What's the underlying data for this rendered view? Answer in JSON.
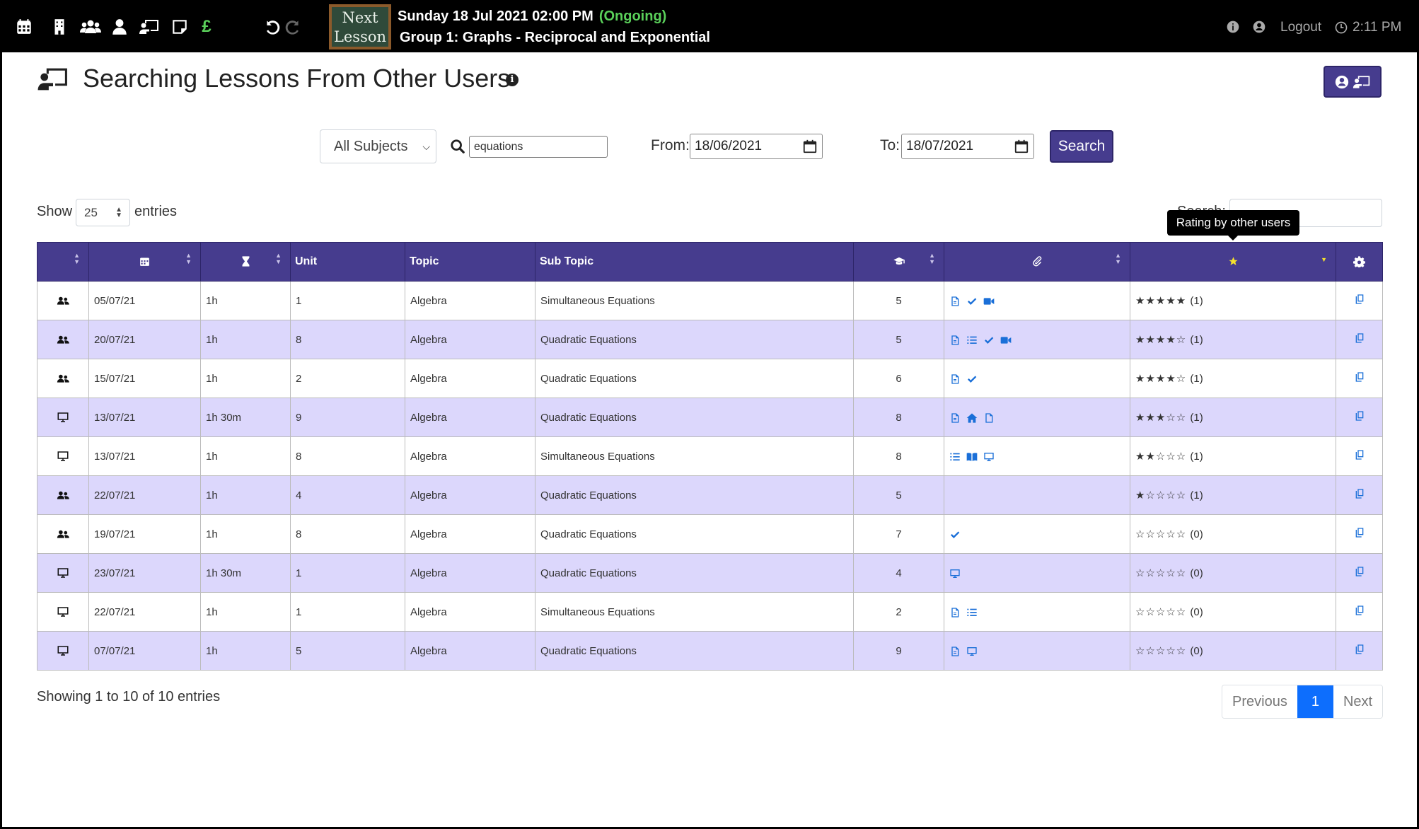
{
  "topbar": {
    "icons": [
      "calendar-icon",
      "building-icon",
      "group-icon",
      "user-icon",
      "presentation-icon",
      "note-icon",
      "pound-icon",
      "undo-icon",
      "redo-icon"
    ],
    "pound_symbol": "£",
    "next_lesson_line1": "Next",
    "next_lesson_line2": "Lesson",
    "lesson_datetime": "Sunday 18 Jul 2021 02:00 PM",
    "lesson_status": "(Ongoing)",
    "lesson_title": "Group 1: Graphs - Reciprocal and Exponential",
    "logout_label": "Logout",
    "time": "2:11 PM",
    "accent_color": "#5ad05a"
  },
  "page": {
    "title": "Searching Lessons From Other Users",
    "info_glyph": "i"
  },
  "filters": {
    "subject": "All Subjects",
    "search_value": "equations",
    "from_label": "From:",
    "from_value": "18/06/2021",
    "to_label": "To:",
    "to_value": "18/07/2021",
    "search_button": "Search"
  },
  "table_controls": {
    "show_label": "Show",
    "entries_value": "25",
    "entries_label": "entries",
    "search_label": "Search:"
  },
  "tooltip": "Rating by other users",
  "table": {
    "headers": {
      "unit": "Unit",
      "topic": "Topic",
      "sub_topic": "Sub Topic"
    },
    "header_color": "#463c8e",
    "row_alt_color": "#dcd7fc",
    "rows": [
      {
        "type": "group",
        "date": "05/07/21",
        "duration": "1h",
        "unit": "1",
        "topic": "Algebra",
        "sub_topic": "Simultaneous Equations",
        "level": "5",
        "attachments": [
          "document-icon",
          "check-icon",
          "video-icon"
        ],
        "stars": "★★★★★",
        "rating": "(1)"
      },
      {
        "type": "group",
        "date": "20/07/21",
        "duration": "1h",
        "unit": "8",
        "topic": "Algebra",
        "sub_topic": "Quadratic Equations",
        "level": "5",
        "attachments": [
          "document-icon",
          "list-icon",
          "check-icon",
          "video-icon"
        ],
        "stars": "★★★★☆",
        "rating": "(1)"
      },
      {
        "type": "group",
        "date": "15/07/21",
        "duration": "1h",
        "unit": "2",
        "topic": "Algebra",
        "sub_topic": "Quadratic Equations",
        "level": "6",
        "attachments": [
          "document-icon",
          "check-icon"
        ],
        "stars": "★★★★☆",
        "rating": "(1)"
      },
      {
        "type": "screen",
        "date": "13/07/21",
        "duration": "1h 30m",
        "unit": "9",
        "topic": "Algebra",
        "sub_topic": "Quadratic Equations",
        "level": "8",
        "attachments": [
          "document-icon",
          "home-icon",
          "file-icon"
        ],
        "stars": "★★★☆☆",
        "rating": "(1)"
      },
      {
        "type": "screen",
        "date": "13/07/21",
        "duration": "1h",
        "unit": "8",
        "topic": "Algebra",
        "sub_topic": "Simultaneous Equations",
        "level": "8",
        "attachments": [
          "list-icon",
          "book-icon",
          "monitor-icon"
        ],
        "stars": "★★☆☆☆",
        "rating": "(1)"
      },
      {
        "type": "group",
        "date": "22/07/21",
        "duration": "1h",
        "unit": "4",
        "topic": "Algebra",
        "sub_topic": "Quadratic Equations",
        "level": "5",
        "attachments": [],
        "stars": "★☆☆☆☆",
        "rating": "(1)"
      },
      {
        "type": "group",
        "date": "19/07/21",
        "duration": "1h",
        "unit": "8",
        "topic": "Algebra",
        "sub_topic": "Quadratic Equations",
        "level": "7",
        "attachments": [
          "check-icon"
        ],
        "stars": "☆☆☆☆☆",
        "rating": "(0)"
      },
      {
        "type": "screen",
        "date": "23/07/21",
        "duration": "1h 30m",
        "unit": "1",
        "topic": "Algebra",
        "sub_topic": "Quadratic Equations",
        "level": "4",
        "attachments": [
          "monitor-icon"
        ],
        "stars": "☆☆☆☆☆",
        "rating": "(0)"
      },
      {
        "type": "screen",
        "date": "22/07/21",
        "duration": "1h",
        "unit": "1",
        "topic": "Algebra",
        "sub_topic": "Simultaneous Equations",
        "level": "2",
        "attachments": [
          "document-icon",
          "list-icon"
        ],
        "stars": "☆☆☆☆☆",
        "rating": "(0)"
      },
      {
        "type": "screen",
        "date": "07/07/21",
        "duration": "1h",
        "unit": "5",
        "topic": "Algebra",
        "sub_topic": "Quadratic Equations",
        "level": "9",
        "attachments": [
          "document-icon",
          "monitor-icon"
        ],
        "stars": "☆☆☆☆☆",
        "rating": "(0)"
      }
    ]
  },
  "footer": {
    "showing": "Showing 1 to 10 of 10 entries",
    "previous": "Previous",
    "page": "1",
    "next": "Next"
  }
}
